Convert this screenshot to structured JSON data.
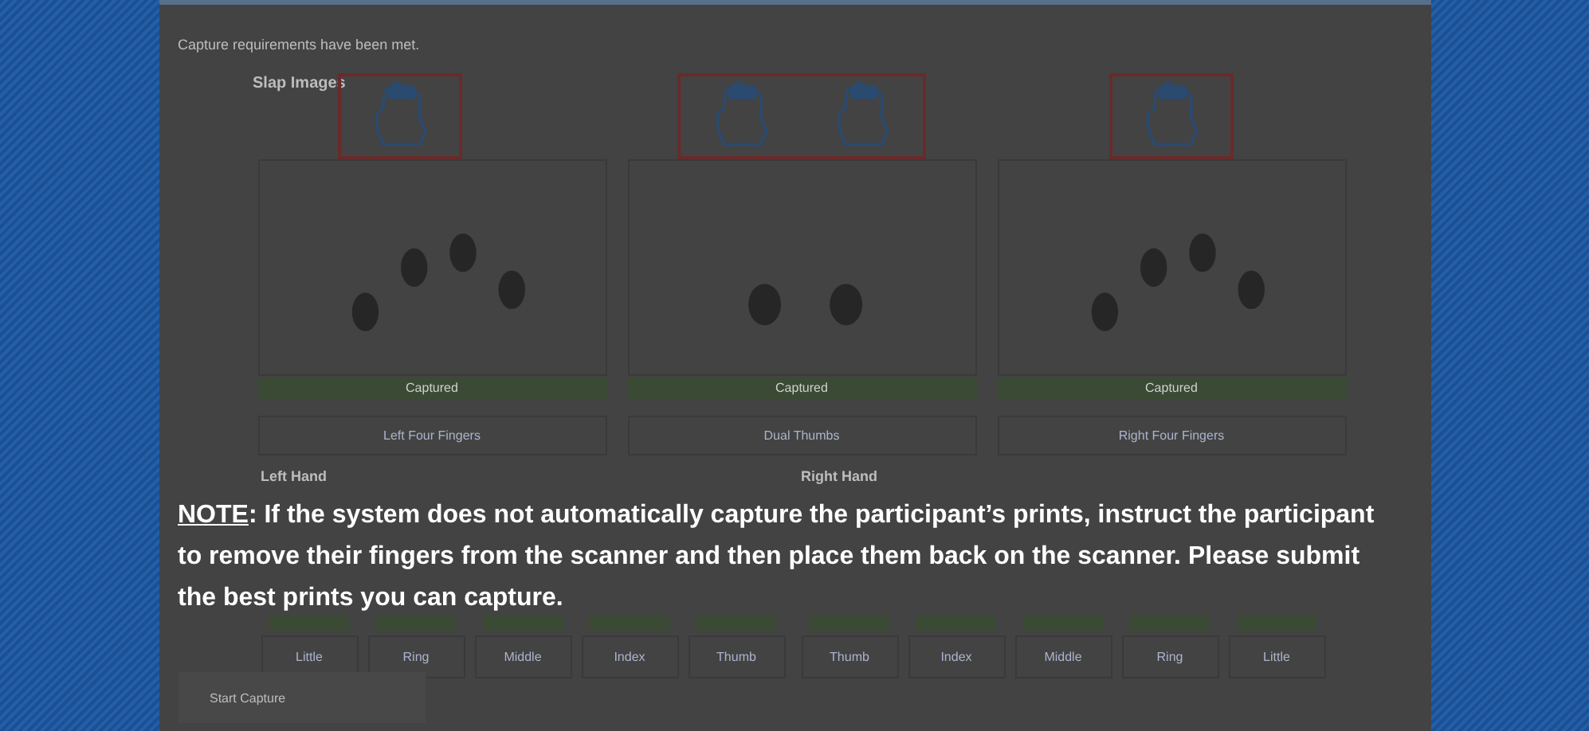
{
  "status_message": "Capture requirements have been met.",
  "slap_section": {
    "title": "Slap Images",
    "slaps": [
      {
        "kind": "fingers",
        "status": "Captured",
        "label": "Left Four Fingers"
      },
      {
        "kind": "thumbs",
        "status": "Captured",
        "label": "Dual Thumbs"
      },
      {
        "kind": "fingers",
        "status": "Captured",
        "label": "Right Four Fingers"
      }
    ]
  },
  "left_hand": {
    "title": "Left Hand",
    "fingers": [
      "Little",
      "Ring",
      "Middle",
      "Index",
      "Thumb"
    ]
  },
  "right_hand": {
    "title": "Right Hand",
    "fingers": [
      "Thumb",
      "Index",
      "Middle",
      "Ring",
      "Little"
    ]
  },
  "start_button": "Start Capture",
  "note": {
    "label": "NOTE",
    "text": ": If the system does not automatically capture the participant’s prints, instruct the participant to remove their fingers from the scanner and then place them back on the scanner.  Please submit the best prints you can capture."
  }
}
